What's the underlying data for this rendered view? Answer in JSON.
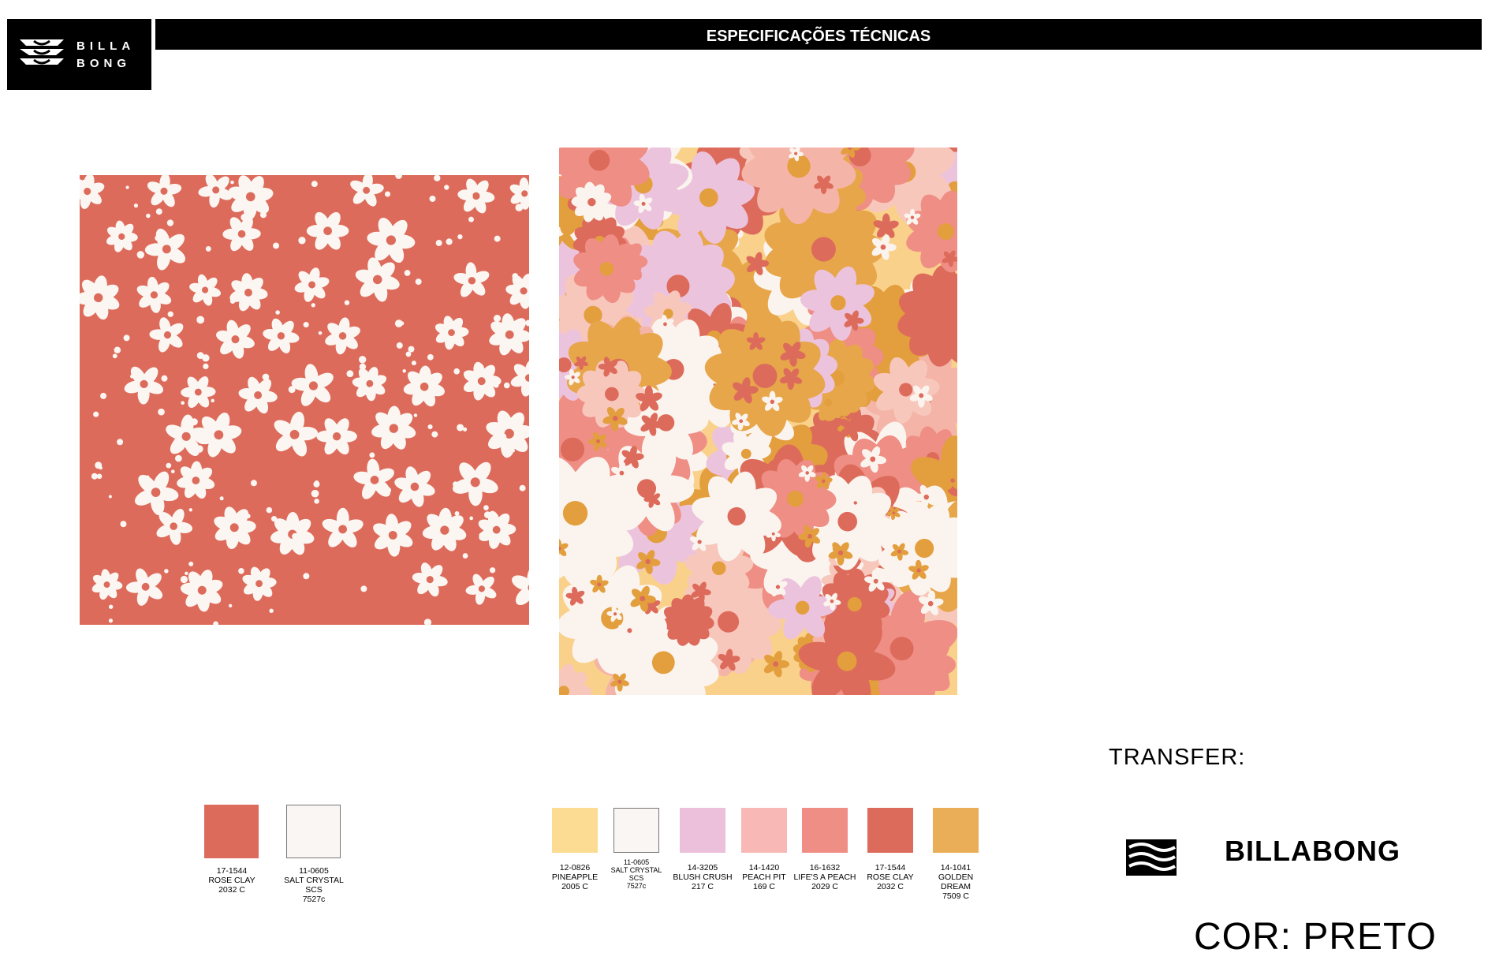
{
  "header": {
    "title": "ESPECIFICAÇÕES TÉCNICAS",
    "logo_text": "BILLA\nBONG"
  },
  "patterns": [
    {
      "name": "small-floral",
      "background": "#DD6B5B",
      "flower_color": "#FBF6F2"
    },
    {
      "name": "large-floral",
      "background": "#F9D18B"
    }
  ],
  "palette_1": {
    "swatches": [
      {
        "color": "#DD6B5B",
        "label": "17-1544\nROSE CLAY\n2032 C"
      },
      {
        "color": "#F9F6F3",
        "label": "11-0605\nSALT CRYSTAL\nSCS\n7527c"
      }
    ]
  },
  "palette_2": {
    "swatches": [
      {
        "color": "#FCDC92",
        "label": "12-0826\nPINEAPPLE\n2005 C"
      },
      {
        "color": "#F9F6F3",
        "label": "11-0605\nSALT CRYSTAL\nSCS\n7527c"
      },
      {
        "color": "#ECC0DA",
        "label": "14-3205\nBLUSH CRUSH\n217 C"
      },
      {
        "color": "#F8B9B6",
        "label": "14-1420\nPEACH PIT\n169 C"
      },
      {
        "color": "#EF8E85",
        "label": "16-1632\nLIFE'S A PEACH\n2029 C"
      },
      {
        "color": "#DD6B5B",
        "label": "17-1544\nROSE CLAY\n2032 C"
      },
      {
        "color": "#EAAE58",
        "label": "14-1041\nGOLDEN\nDREAM\n7509 C"
      }
    ]
  },
  "transfer": {
    "label": "TRANSFER:",
    "brand": "BILLABONG",
    "color_note": "COR: PRETO"
  }
}
